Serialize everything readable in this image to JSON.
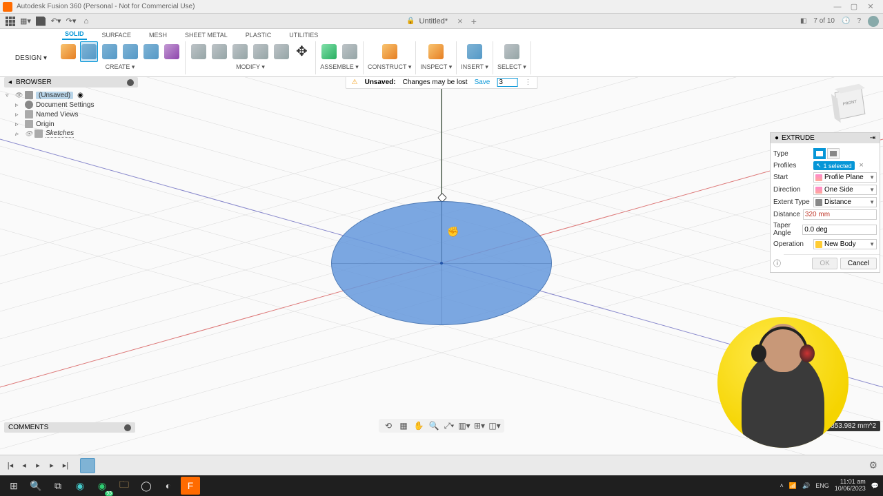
{
  "app": {
    "title": "Autodesk Fusion 360 (Personal - Not for Commercial Use)"
  },
  "document": {
    "name": "Untitled*",
    "job_status": "7 of 10"
  },
  "workspace": {
    "label": "DESIGN ▾"
  },
  "ribbon": {
    "tabs": [
      "SOLID",
      "SURFACE",
      "MESH",
      "SHEET METAL",
      "PLASTIC",
      "UTILITIES"
    ],
    "active_tab": "SOLID",
    "groups": {
      "create": "CREATE ▾",
      "modify": "MODIFY ▾",
      "assemble": "ASSEMBLE ▾",
      "construct": "CONSTRUCT ▾",
      "inspect": "INSPECT ▾",
      "insert": "INSERT ▾",
      "select": "SELECT ▾"
    }
  },
  "unsaved": {
    "badge": "Unsaved:",
    "msg": "Changes may be lost",
    "save": "Save",
    "input": "3"
  },
  "browser": {
    "title": "BROWSER",
    "root": "(Unsaved)",
    "items": [
      "Document Settings",
      "Named Views",
      "Origin",
      "Sketches"
    ]
  },
  "extrude": {
    "title": "EXTRUDE",
    "type_label": "Type",
    "profiles_label": "Profiles",
    "profiles_value": "1 selected",
    "start_label": "Start",
    "start_value": "Profile Plane",
    "direction_label": "Direction",
    "direction_value": "One Side",
    "extent_label": "Extent Type",
    "extent_value": "Distance",
    "distance_label": "Distance",
    "distance_value": "320 mm",
    "taper_label": "Taper Angle",
    "taper_value": "0.0 deg",
    "operation_label": "Operation",
    "operation_value": "New Body",
    "ok": "OK",
    "cancel": "Cancel"
  },
  "area": {
    "text": "Area : 7853.982 mm^2"
  },
  "comments": {
    "label": "COMMENTS"
  },
  "clock": {
    "time": "11:01 am",
    "date": "10/06/2023"
  },
  "whatsapp_badge": "93"
}
